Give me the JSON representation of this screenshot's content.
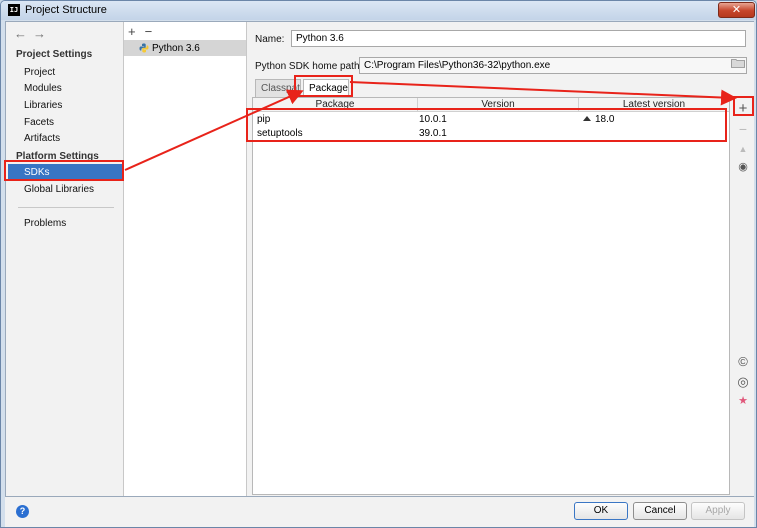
{
  "window": {
    "title": "Project Structure",
    "close_label": "✕"
  },
  "nav": {
    "back": "←",
    "forward": "→",
    "project_settings": "Project Settings",
    "project_items": [
      "Project",
      "Modules",
      "Libraries",
      "Facets",
      "Artifacts"
    ],
    "platform_settings": "Platform Settings",
    "sdks": "SDKs",
    "global_libraries": "Global Libraries",
    "problems": "Problems"
  },
  "sdk_list": {
    "add": "+",
    "remove": "−",
    "items": [
      "Python 3.6"
    ]
  },
  "detail": {
    "name_label": "Name:",
    "name_value": "Python 3.6",
    "home_label": "Python SDK home path:",
    "home_value": "C:\\Program Files\\Python36-32\\python.exe",
    "tabs": {
      "classpath": "Classpath",
      "packages": "Packages"
    }
  },
  "packages_table": {
    "columns": [
      "Package",
      "Version",
      "Latest version"
    ],
    "rows": [
      {
        "package": "pip",
        "version": "10.0.1",
        "latest": "18.0"
      },
      {
        "package": "setuptools",
        "version": "39.0.1",
        "latest": ""
      }
    ]
  },
  "side_tools": {
    "add": "+",
    "remove": "−",
    "upgrade": "▲",
    "show": "◉",
    "conda": "©",
    "options": "◎",
    "star": "★"
  },
  "footer": {
    "help": "?",
    "ok": "OK",
    "cancel": "Cancel",
    "apply": "Apply"
  },
  "colors": {
    "selection": "#3875c4",
    "highlight": "#e8231a"
  }
}
